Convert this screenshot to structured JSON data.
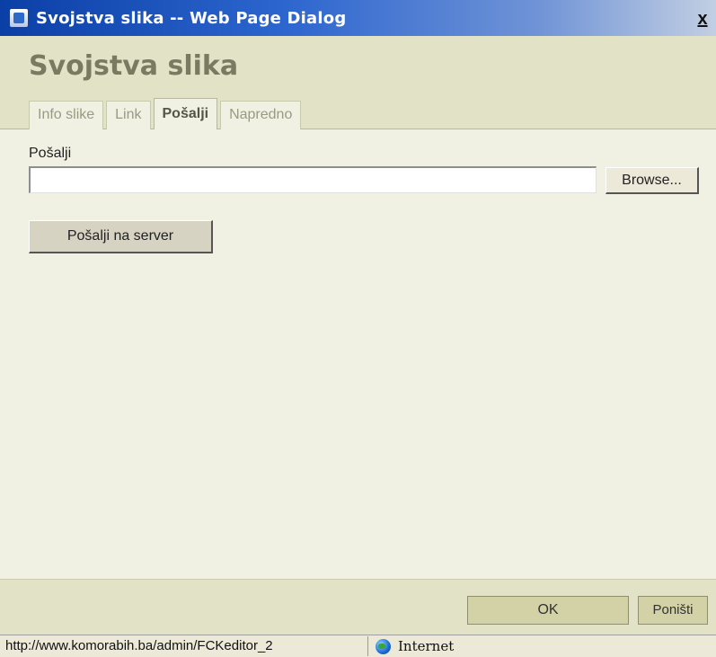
{
  "window": {
    "title": "Svojstva slika -- Web Page Dialog",
    "close_glyph": "x"
  },
  "dialog": {
    "heading": "Svojstva slika",
    "tabs": [
      {
        "label": "Info slike",
        "active": false
      },
      {
        "label": "Link",
        "active": false
      },
      {
        "label": "Pošalji",
        "active": true
      },
      {
        "label": "Napredno",
        "active": false
      }
    ]
  },
  "upload": {
    "field_label": "Pošalji",
    "file_value": "",
    "browse_label": "Browse...",
    "send_label": "Pošalji na server"
  },
  "footer": {
    "ok_label": "OK",
    "cancel_label": "Poništi"
  },
  "statusbar": {
    "url": "http://www.komorabih.ba/admin/FCKeditor_2",
    "zone": "Internet",
    "zone_icon": "globe-icon"
  }
}
